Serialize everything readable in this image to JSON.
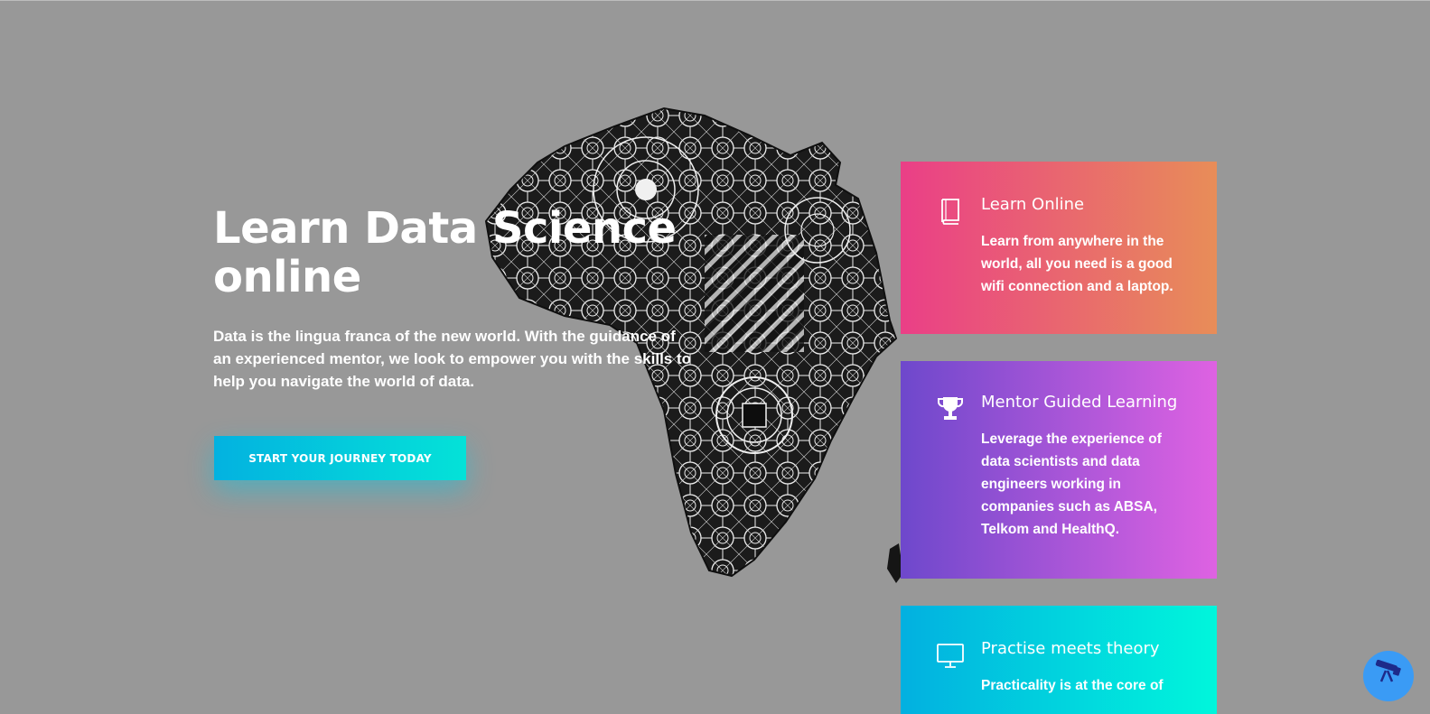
{
  "hero": {
    "title": "Learn Data Science online",
    "description": "Data is the lingua franca of the new world. With the guidance of an experienced mentor, we look to empower you with the skills to help you navigate the world of data.",
    "cta_label": "START YOUR JOURNEY TODAY"
  },
  "features": [
    {
      "icon": "book-icon",
      "title": "Learn Online",
      "text": "Learn from anywhere in the world, all you need is a good wifi connection and a laptop."
    },
    {
      "icon": "trophy-icon",
      "title": "Mentor Guided Learning",
      "text": "Leverage the experience of data scientists and data engineers working in companies such as ABSA, Telkom and HealthQ."
    },
    {
      "icon": "monitor-icon",
      "title": "Practise meets theory",
      "text": "Practicality is at the core of"
    }
  ],
  "chat_widget": {
    "icon": "telescope-icon"
  },
  "colors": {
    "background": "#989898",
    "card_1": [
      "#ea3f87",
      "#e88d58"
    ],
    "card_2": [
      "#6e48cc",
      "#de62e2"
    ],
    "card_3": [
      "#02b0e0",
      "#00f6dc"
    ],
    "cta": [
      "#03b2e0",
      "#04e2d8"
    ],
    "chat_button": "#3a9bf5"
  }
}
